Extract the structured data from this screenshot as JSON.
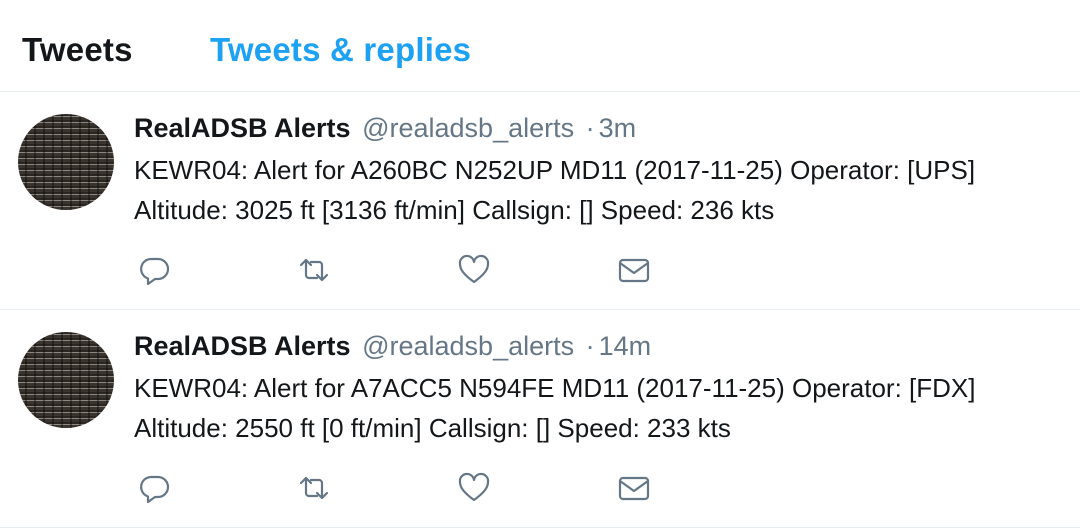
{
  "tabs": [
    {
      "label": "Tweets"
    },
    {
      "label": "Tweets & replies"
    }
  ],
  "colors": {
    "accent": "#1da1f2",
    "text": "#14171a",
    "muted": "#657786",
    "border": "#e6ecf0"
  },
  "tweets": [
    {
      "name": "RealADSB Alerts",
      "handle": "@realadsb_alerts",
      "separator": "·",
      "time": "3m",
      "text": "KEWR04: Alert for A260BC N252UP MD11 (2017-11-25) Operator: [UPS] Altitude: 3025 ft [3136 ft/min] Callsign: [] Speed: 236 kts",
      "actions": [
        "reply-icon",
        "retweet-icon",
        "like-icon",
        "direct-message-icon"
      ]
    },
    {
      "name": "RealADSB Alerts",
      "handle": "@realadsb_alerts",
      "separator": "·",
      "time": "14m",
      "text": "KEWR04: Alert for A7ACC5 N594FE MD11 (2017-11-25) Operator: [FDX] Altitude: 2550 ft [0 ft/min] Callsign: [] Speed: 233 kts",
      "actions": [
        "reply-icon",
        "retweet-icon",
        "like-icon",
        "direct-message-icon"
      ]
    }
  ]
}
